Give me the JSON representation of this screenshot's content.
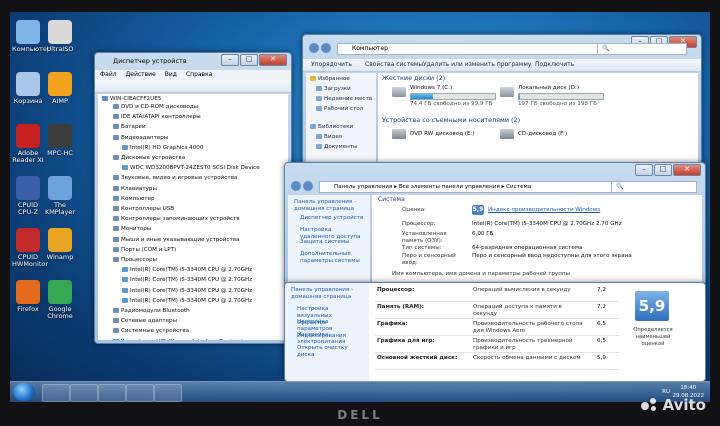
{
  "desktop_icons": [
    {
      "label": "Компьютер",
      "color": "#7fb4e6"
    },
    {
      "label": "UltraISO",
      "color": "#d9d9d9"
    },
    {
      "label": "Корзина",
      "color": "#a9c6e8"
    },
    {
      "label": "AIMP",
      "color": "#f3a21f"
    },
    {
      "label": "Adobe Reader XI",
      "color": "#c52121"
    },
    {
      "label": "MPC-HC",
      "color": "#3c3c3c"
    },
    {
      "label": "CPUID CPU-Z",
      "color": "#3b5ea8"
    },
    {
      "label": "The KMPlayer",
      "color": "#6fa3e0"
    },
    {
      "label": "CPUID HWMonitor",
      "color": "#c02a2a"
    },
    {
      "label": "Winamp",
      "color": "#e9a424"
    },
    {
      "label": "Firefox",
      "color": "#e46a1c"
    },
    {
      "label": "Google Chrome",
      "color": "#36a853"
    }
  ],
  "device_manager": {
    "title": "Диспетчер устройств",
    "menu": [
      "Файл",
      "Действие",
      "Вид",
      "Справка"
    ],
    "root": "WIN-CIEACFF2UE5",
    "tree": [
      {
        "text": "DVD и CD-ROM дисководы",
        "level": 1
      },
      {
        "text": "IDE ATA/ATAPI контроллеры",
        "level": 1
      },
      {
        "text": "Батареи",
        "level": 1
      },
      {
        "text": "Видеоадаптеры",
        "level": 1
      },
      {
        "text": "Intel(R) HD Graphics 4000",
        "level": 2
      },
      {
        "text": "Дисковые устройства",
        "level": 1
      },
      {
        "text": "WDC WD3200BPVT-24ZEST0 SCSI Disk Device",
        "level": 2
      },
      {
        "text": "Звуковые, видео и игровые устройства",
        "level": 1
      },
      {
        "text": "Клавиатуры",
        "level": 1
      },
      {
        "text": "Компьютер",
        "level": 1
      },
      {
        "text": "Контроллеры USB",
        "level": 1
      },
      {
        "text": "Контроллеры запоминающих устройств",
        "level": 1
      },
      {
        "text": "Мониторы",
        "level": 1
      },
      {
        "text": "Мыши и иные указывающие устройства",
        "level": 1
      },
      {
        "text": "Порты (COM и LPT)",
        "level": 1
      },
      {
        "text": "Процессоры",
        "level": 1
      },
      {
        "text": "Intel(R) Core(TM) i5-3340M CPU @ 2.70GHz",
        "level": 2
      },
      {
        "text": "Intel(R) Core(TM) i5-3340M CPU @ 2.70GHz",
        "level": 2
      },
      {
        "text": "Intel(R) Core(TM) i5-3340M CPU @ 2.70GHz",
        "level": 2
      },
      {
        "text": "Intel(R) Core(TM) i5-3340M CPU @ 2.70GHz",
        "level": 2
      },
      {
        "text": "Радиомодули Bluetooth",
        "level": 1
      },
      {
        "text": "Сетевые адаптеры",
        "level": 1
      },
      {
        "text": "Системные устройства",
        "level": 1
      },
      {
        "text": "Устройства HID (Human Interface Devices)",
        "level": 1
      }
    ]
  },
  "explorer": {
    "address": "Компьютер",
    "toolbar": [
      "Упорядочить",
      "Свойства системы",
      "Удалить или изменить программу",
      "Подключить"
    ],
    "nav": [
      "Избранное",
      "Загрузки",
      "Недавние места",
      "Рабочий стол",
      "Библиотеки",
      "Видео",
      "Документы"
    ],
    "hdd_header": "Жесткие диски (2)",
    "drives": [
      {
        "name": "Windows 7 (C:)",
        "free": "74,4 ГБ свободно из 99,9 ГБ",
        "fill": 0.26
      },
      {
        "name": "Локальный диск (D:)",
        "free": "197 ГБ свободно из 198 ГБ",
        "fill": 0.01
      }
    ],
    "removable_header": "Устройства со съемными носителями (2)",
    "removable": [
      "DVD RW дисковод (E:)",
      "CD-дисковод (F:)"
    ]
  },
  "system": {
    "address": [
      "Панель управления",
      "Все элементы панели управления",
      "Система"
    ],
    "left_links": [
      "Панель управления - домашняя страница",
      "Диспетчер устройств",
      "Настройка удаленного доступа",
      "Защита системы",
      "Дополнительные параметры системы"
    ],
    "section": "Система",
    "rating_label": "Оценка:",
    "rating_value": "5,9",
    "rating_link": "Индекс производительности Windows",
    "rows": [
      {
        "label": "Процессор:",
        "value": "Intel(R) Core(TM) i5-3340M CPU @ 2.70GHz  2.70 GHz"
      },
      {
        "label": "Установленная память (ОЗУ):",
        "value": "6,00 ГБ"
      },
      {
        "label": "Тип системы:",
        "value": "64-разрядная операционная система"
      },
      {
        "label": "Перо и сенсорный ввод:",
        "value": "Перо и сенсорный ввод недоступны для этого экрана"
      }
    ],
    "footer": "Имя компьютера, имя домена и параметры рабочей группы"
  },
  "wei": {
    "left_links": [
      "Панель управления - домашняя страница",
      "Настройка визуальных эффектов",
      "Настройка параметров индексирования",
      "Настройка электропитания",
      "Открыть очистку диска"
    ],
    "rows": [
      {
        "component": "Процессор:",
        "desc": "Операций вычисления в секунду",
        "score": "7,2"
      },
      {
        "component": "Память (RAM):",
        "desc": "Операций доступа к памяти в секунду",
        "score": "7,2"
      },
      {
        "component": "Графика:",
        "desc": "Производительность рабочего стола для Windows Aero",
        "score": "6,5"
      },
      {
        "component": "Графика для игр:",
        "desc": "Производительность трехмерной графики и игр",
        "score": "6,5"
      },
      {
        "component": "Основной жесткий диск:",
        "desc": "Скорость обмена данными с диском",
        "score": "5,9"
      }
    ],
    "base_score": "5,9",
    "base_caption": "Определяется наименьшей оценкой"
  },
  "taskbar": {
    "lang": "RU",
    "time": "18:40",
    "date": "29.08.2022"
  },
  "brand": "DELL",
  "watermark": "Avito"
}
